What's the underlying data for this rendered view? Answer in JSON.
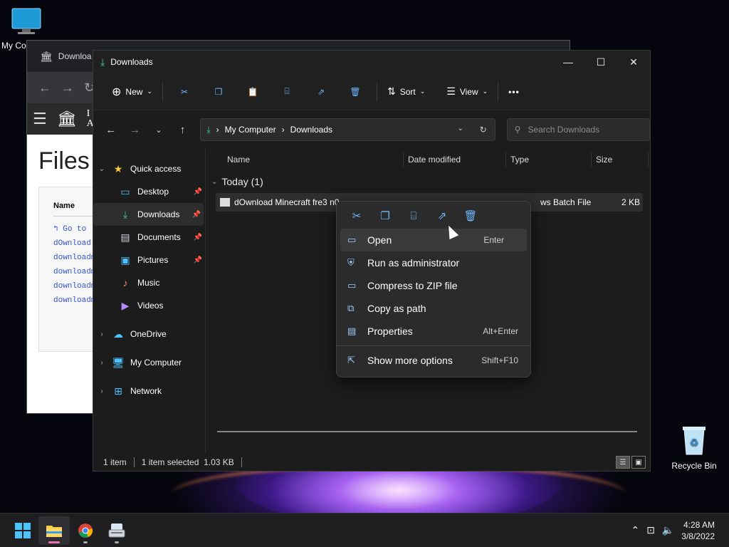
{
  "desktop": {
    "icons": [
      {
        "label": "My Co"
      },
      {
        "label": "Recycle Bin"
      }
    ]
  },
  "browser": {
    "tab_title": "Downloa",
    "page_heading": "Files",
    "header_text": "I",
    "header_text2": "A",
    "listing": {
      "column": "Name",
      "rows": [
        "↰ Go to",
        "dOwnload (",
        "downloadm:",
        "downloadm:",
        "downloadm:",
        "downloadm:"
      ]
    }
  },
  "explorer": {
    "title": "Downloads",
    "window_buttons": {
      "minimize": "—",
      "maximize": "☐",
      "close": "✕"
    },
    "toolbar": {
      "new_label": "New",
      "sort_label": "Sort",
      "view_label": "View",
      "more_label": "•••"
    },
    "address": {
      "segments": [
        "My Computer",
        "Downloads"
      ],
      "search_placeholder": "Search Downloads"
    },
    "sidebar": {
      "quick_access": "Quick access",
      "items": [
        {
          "label": "Desktop",
          "icon": "desktop-folder-icon",
          "pinned": true
        },
        {
          "label": "Downloads",
          "icon": "downloads-folder-icon",
          "pinned": true,
          "selected": true
        },
        {
          "label": "Documents",
          "icon": "documents-folder-icon",
          "pinned": true
        },
        {
          "label": "Pictures",
          "icon": "pictures-folder-icon",
          "pinned": true
        },
        {
          "label": "Music",
          "icon": "music-folder-icon",
          "pinned": false
        },
        {
          "label": "Videos",
          "icon": "videos-folder-icon",
          "pinned": false
        }
      ],
      "roots": [
        {
          "label": "OneDrive",
          "icon": "onedrive-icon"
        },
        {
          "label": "My Computer",
          "icon": "computer-icon"
        },
        {
          "label": "Network",
          "icon": "network-icon"
        }
      ]
    },
    "columns": {
      "name": "Name",
      "date": "Date modified",
      "type": "Type",
      "size": "Size"
    },
    "group_label": "Today (1)",
    "file": {
      "name": "dOwnload Minecraft fre3 n0",
      "type": "ws Batch File",
      "size": "2 KB"
    },
    "status": {
      "count": "1 item",
      "selected": "1 item selected  1.03 KB"
    }
  },
  "context_menu": {
    "items": [
      {
        "label": "Open",
        "shortcut": "Enter",
        "icon": "open-icon"
      },
      {
        "label": "Run as administrator",
        "shortcut": "",
        "icon": "shield-icon"
      },
      {
        "label": "Compress to ZIP file",
        "shortcut": "",
        "icon": "zip-icon"
      },
      {
        "label": "Copy as path",
        "shortcut": "",
        "icon": "copy-path-icon"
      },
      {
        "label": "Properties",
        "shortcut": "Alt+Enter",
        "icon": "properties-icon"
      },
      {
        "label": "Show more options",
        "shortcut": "Shift+F10",
        "icon": "more-options-icon"
      }
    ]
  },
  "taskbar": {
    "time": "4:28 AM",
    "date": "3/8/2022"
  },
  "colors": {
    "accent": "#6fb8ff",
    "download_green": "#3fcf8e",
    "active_indicator": "#e86fb2"
  }
}
